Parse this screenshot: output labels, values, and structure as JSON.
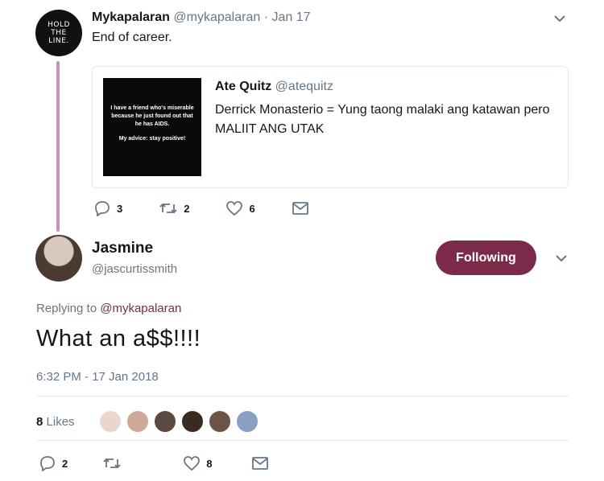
{
  "parent_tweet": {
    "brand_avatar_lines": [
      "HOLD",
      "THE",
      "LINE."
    ],
    "name": "Mykapalaran",
    "handle": "@mykapalaran",
    "separator": "·",
    "date": "Jan 17",
    "text": "End of career.",
    "quote": {
      "image_lines": [
        "I have a friend who's miserable because he just found out that he has AIDS.",
        "My advice: stay positive!"
      ],
      "name": "Ate Quitz",
      "handle": "@atequitz",
      "text": "Derrick Monasterio = Yung taong malaki ang katawan pero MALIIT ANG UTAK"
    },
    "actions": {
      "replies": "3",
      "retweets": "2",
      "likes": "6"
    }
  },
  "main_tweet": {
    "name": "Jasmine",
    "handle": "@jascurtissmith",
    "follow_label": "Following",
    "replying_prefix": "Replying to",
    "replying_to": "@mykapalaran",
    "text": "What an a$$!!!!",
    "timestamp": "6:32 PM - 17 Jan 2018",
    "likes_count": "8",
    "likes_word": "Likes",
    "liker_colors": [
      "#e9d6cc",
      "#cfa995",
      "#5b4a3f",
      "#3a2a22",
      "#6b5346",
      "#8aa0c0"
    ],
    "actions": {
      "replies": "2",
      "retweets": "",
      "likes": "8"
    }
  },
  "colors": {
    "accent": "#7b2a4a",
    "thread_line": "#c197b7",
    "secondary_text": "#657786"
  },
  "icons": [
    "reply-icon",
    "retweet-icon",
    "like-icon",
    "message-icon",
    "chevron-down-icon"
  ]
}
